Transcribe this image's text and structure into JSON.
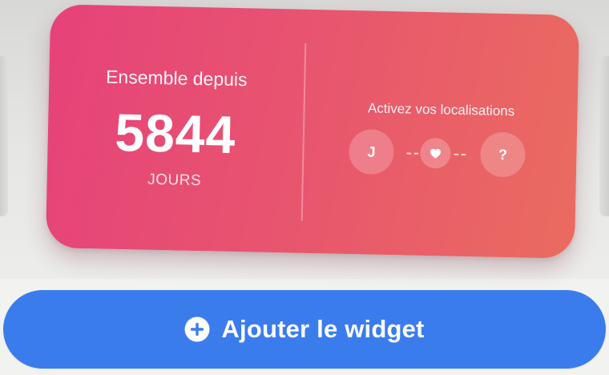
{
  "widget": {
    "since_label": "Ensemble depuis",
    "days_count": "5844",
    "days_unit": "JOURS",
    "location_prompt": "Activez vos localisations",
    "partner_left_initial": "J",
    "partner_right_initial": "?",
    "connector_icon": "heart-icon",
    "gradient_colors": [
      "#e6427a",
      "#ea6b60"
    ]
  },
  "add_button": {
    "label": "Ajouter le widget",
    "icon": "plus-circle-icon",
    "color": "#3b7ced"
  }
}
